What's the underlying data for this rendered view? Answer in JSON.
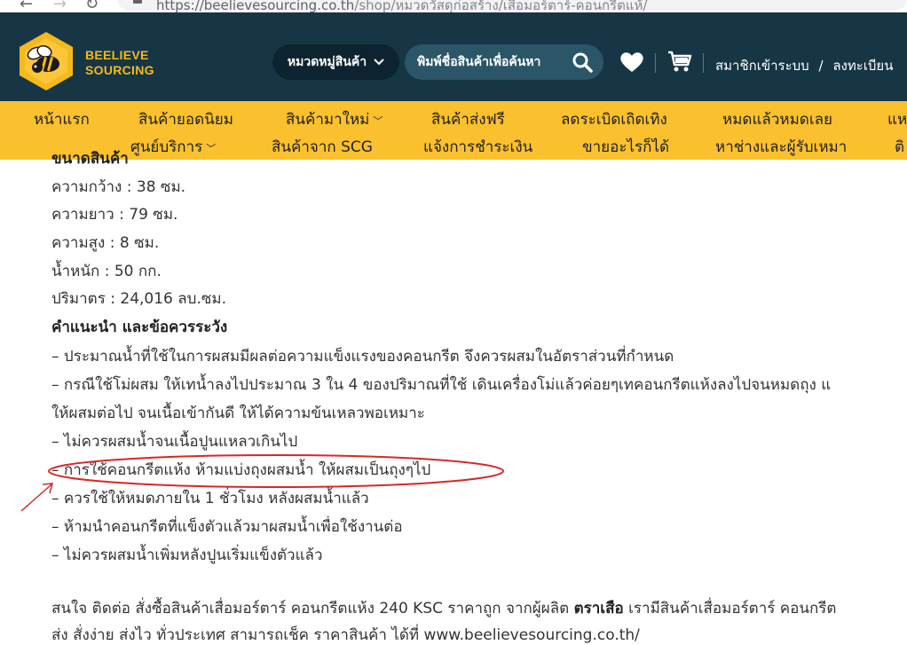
{
  "browser": {
    "url_host": "https://beelievesourcing.co.th",
    "url_path": "/shop/หมวดวัสดุก่อสร้าง/เสื่อมอร์ตาร์-คอนกรีตแห้/"
  },
  "header": {
    "logo_line1": "BEELIEVE",
    "logo_line2": "SOURCING",
    "category_button": "หมวดหมู่สินค้า",
    "search_placeholder": "พิมพ์ชื่อสินค้าเพื่อค้นหา",
    "login": "สมาชิกเข้าระบบ",
    "auth_separator": "/",
    "register": "ลงทะเบียน"
  },
  "menu": {
    "row1": [
      "หน้าแรก",
      "สินค้ายอดนิยม",
      "สินค้ามาใหม่",
      "สินค้าส่งฟรี",
      "ลดระเบิดเถิดเทิง",
      "หมดแล้วหมดเลย",
      "แห"
    ],
    "row2": [
      "ศูนย์บริการ",
      "สินค้าจาก SCG",
      "แจ้งการชำระเงิน",
      "ขายอะไรก็ได้",
      "หาช่างและผู้รับเหมา",
      "ติ"
    ]
  },
  "content": {
    "cut_heading": "ขนาดสินค้า",
    "specs": [
      "ความกว้าง : 38 ซม.",
      "ความยาว : 79 ซม.",
      "ความสูง : 8 ซม.",
      "น้ำหนัก : 50 กก.",
      "ปริมาตร : 24,016 ลบ.ซม."
    ],
    "advice_heading": "คำแนะนำ และข้อควรระวัง",
    "advice": [
      "– ประมาณน้ำที่ใช้ในการผสมมีผลต่อความแข็งแรงของคอนกรีต จึงควรผสมในอัตราส่วนที่กำหนด",
      "– กรณีใช้โม่ผสม ให้เทน้ำลงไปประมาณ 3 ใน 4 ของปริมาณที่ใช้ เดินเครื่องโม่แล้วค่อยๆเทคอนกรีตแห้งลงไปจนหมดถุง แ",
      "ให้ผสมต่อไป จนเนื้อเข้ากันดี ให้ได้ความข้นเหลวพอเหมาะ",
      "– ไม่ควรผสมน้ำจนเนื้อปูนแหลวเกินไป",
      "– การใช้คอนกรีตแห้ง ห้ามแบ่งถุงผสมน้ำ ให้ผสมเป็นถุงๆไป",
      "– ควรใช้ให้หมดภายใน 1 ชั่วโมง หลังผสมน้ำแล้ว",
      "– ห้ามนำคอนกรีตที่แข็งตัวแล้วมาผสมน้ำเพื่อใช้งานต่อ",
      "– ไม่ควรผสมน้ำเพิ่มหลังปูนเริ่มแข็งตัวแล้ว"
    ],
    "footer_line1_pre": "สนใจ ติดต่อ สั่งซื้อสินค้าเสื่อมอร์ตาร์ คอนกรีตแห้ง 240 KSC ราคาถูก จากผู้ผลิต",
    "footer_line1_bold": "ตราเสือ",
    "footer_line1_post": "เรามีสินค้าเสื่อมอร์ตาร์ คอนกรีต",
    "footer_line2_pre": "ส่ง สั่งง่าย ส่งไว ทั่วประเทศ สามารถเช็ค ราคาสินค้า ได้ที่",
    "footer_link": "www.beelievesourcing.co.th/"
  },
  "colors": {
    "header_bg": "#163645",
    "menu_bg": "#fbc02d",
    "brand_yellow": "#f7b81c",
    "annotation_red": "#d62828"
  },
  "icons": [
    "back-arrow-icon",
    "forward-arrow-icon",
    "reload-icon",
    "lock-icon",
    "chevron-down-icon",
    "search-icon",
    "heart-icon",
    "cart-icon",
    "bee-logo-icon"
  ]
}
